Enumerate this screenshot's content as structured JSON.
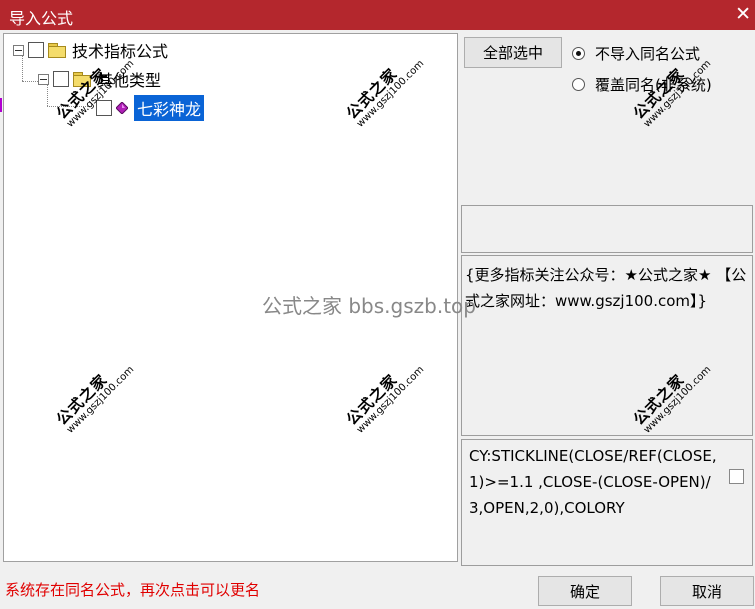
{
  "window": {
    "title": "导入公式",
    "close_glyph": "✕"
  },
  "tree": {
    "nodes": [
      {
        "label": "技术指标公式",
        "icon": "folder-icon",
        "checked": false
      },
      {
        "label": "其他类型",
        "icon": "folder-icon",
        "checked": false
      },
      {
        "label": "七彩神龙",
        "icon": "formula-gem-icon",
        "checked": false,
        "selected": true
      }
    ]
  },
  "options": {
    "select_all_label": "全部选中",
    "radio_no_import": "不导入同名公式",
    "radio_overwrite": "覆盖同名(非系统)",
    "selected_radio": "不导入同名公式"
  },
  "description": "{更多指标关注公众号：★公式之家★ 【公式之家网址：www.gszj100.com】}",
  "code": "CY:STICKLINE(CLOSE/REF(CLOSE,1)>=1.1 ,CLOSE-(CLOSE-OPEN)/3,OPEN,2,0),COLORY",
  "status_message": "系统存在同名公式，再次点击可以更名",
  "buttons": {
    "ok": "确定",
    "cancel": "取消"
  },
  "watermark": {
    "brand": "公式之家",
    "url": "www.gszj100.com",
    "center_text": "公式之家 bbs.gszb.top"
  },
  "colors": {
    "titlebar": "#b4272d",
    "selection": "#0a64d6",
    "status_text": "#e00000"
  }
}
